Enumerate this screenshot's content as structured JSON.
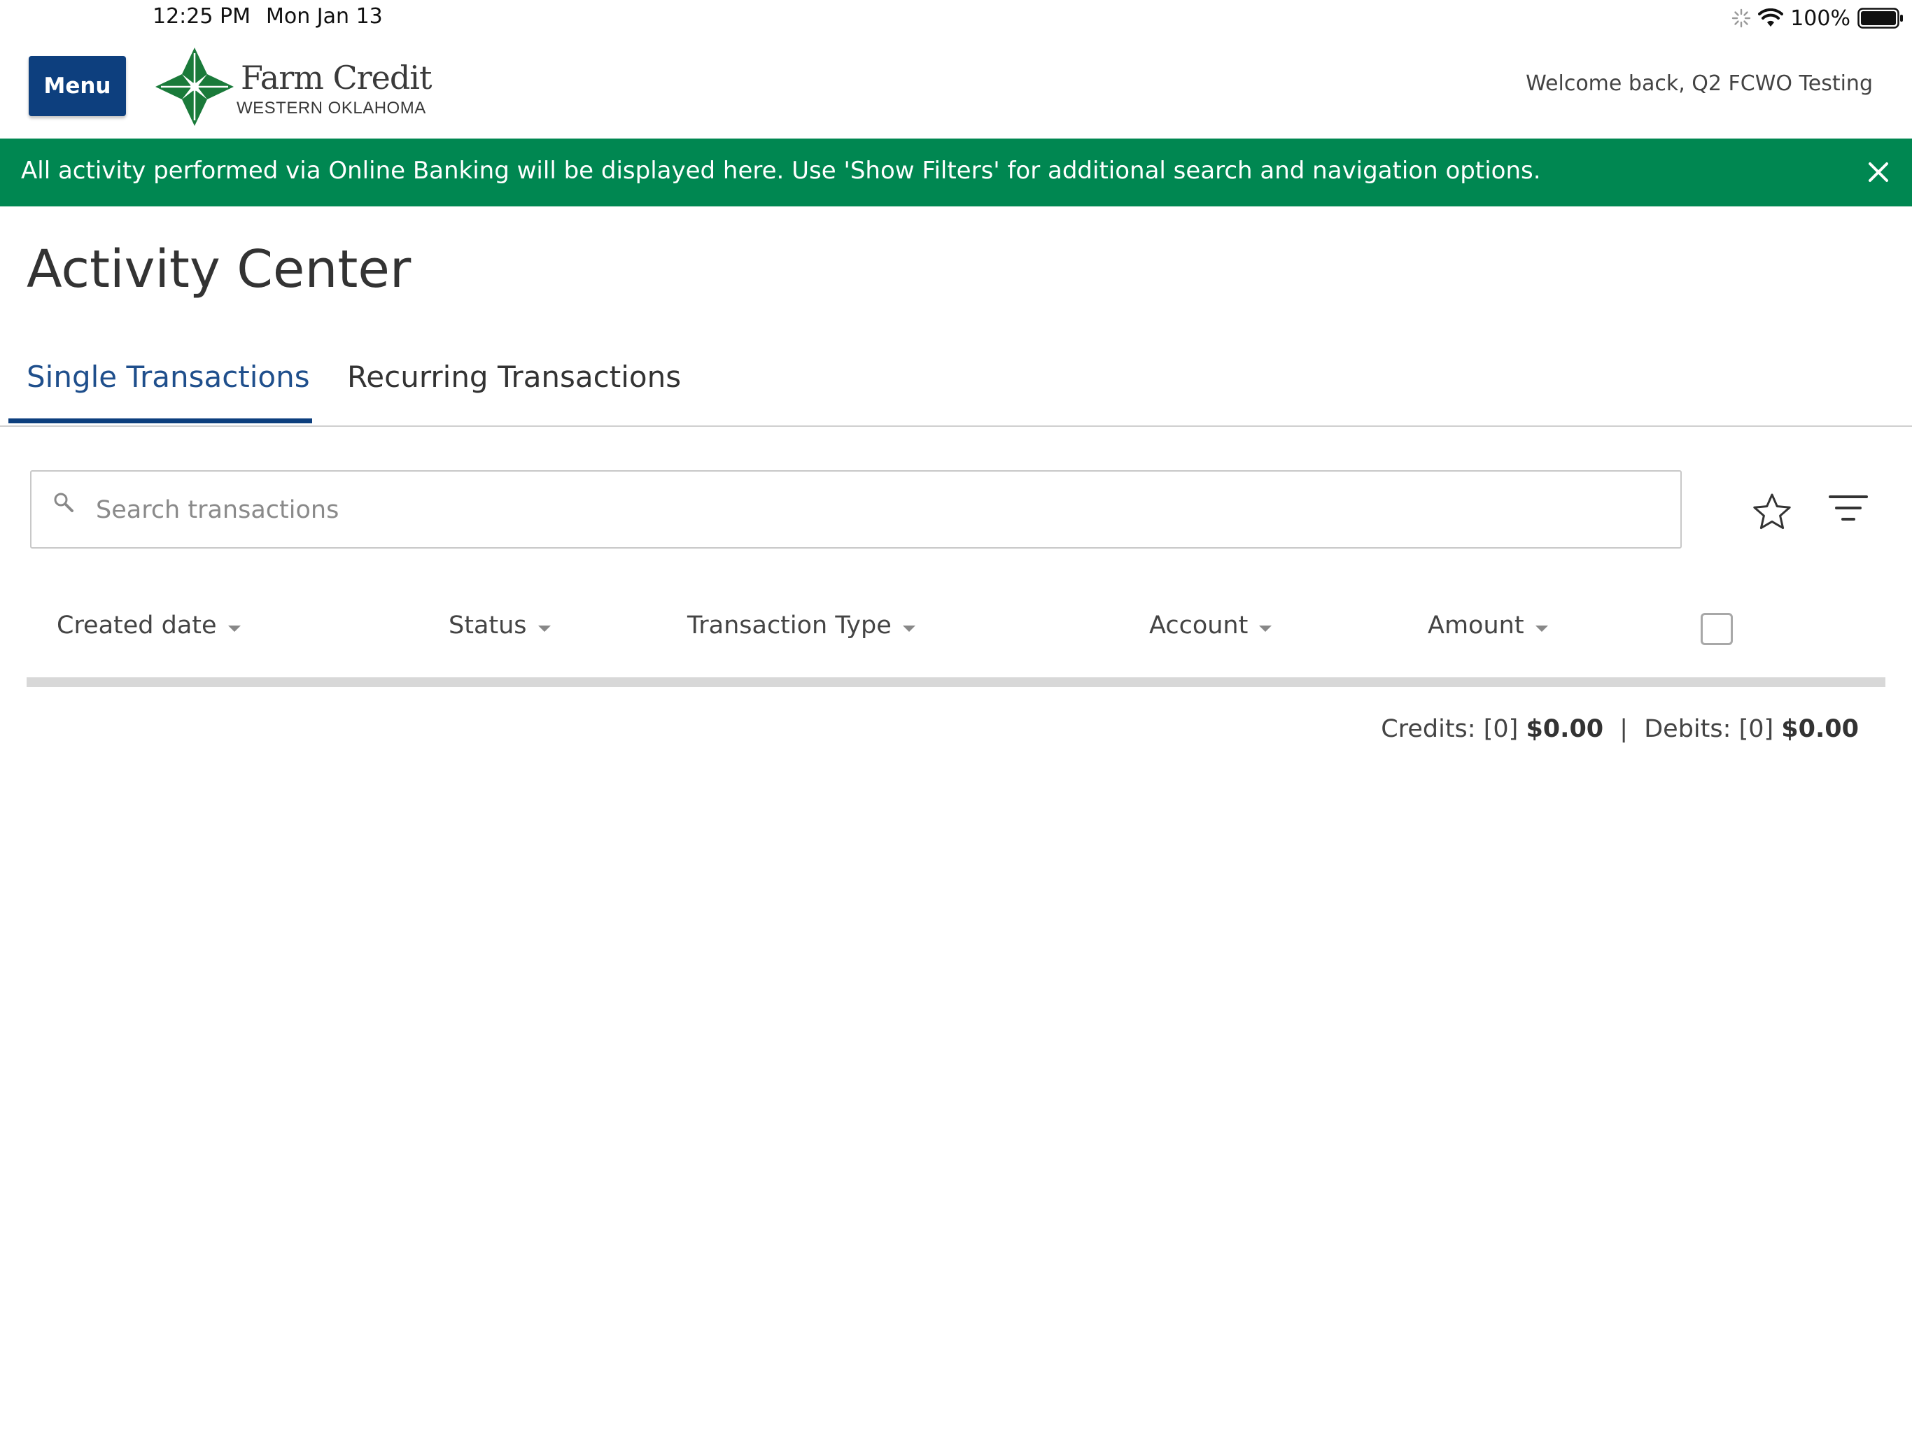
{
  "status_bar": {
    "time": "12:25 PM",
    "date": "Mon Jan 13",
    "battery": "100%"
  },
  "header": {
    "menu_label": "Menu",
    "logo_name": "Farm Credit",
    "logo_sub": "WESTERN OKLAHOMA",
    "welcome": "Welcome back, Q2 FCWO Testing"
  },
  "banner": {
    "message": "All activity performed via Online Banking will be displayed here. Use 'Show Filters' for additional search and navigation options."
  },
  "page": {
    "title": "Activity Center"
  },
  "tabs": [
    {
      "label": "Single Transactions",
      "active": true
    },
    {
      "label": "Recurring Transactions",
      "active": false
    }
  ],
  "search": {
    "placeholder": "Search transactions",
    "value": ""
  },
  "table": {
    "columns": [
      "Created date",
      "Status",
      "Transaction Type",
      "Account",
      "Amount"
    ],
    "rows": []
  },
  "totals": {
    "credits_label": "Credits:",
    "credits_count": "[0]",
    "credits_amount": "$0.00",
    "separator": "|",
    "debits_label": "Debits:",
    "debits_count": "[0]",
    "debits_amount": "$0.00"
  },
  "colors": {
    "brand_blue": "#0d3f7e",
    "banner_green": "#008751",
    "logo_green": "#1a7a3a"
  }
}
